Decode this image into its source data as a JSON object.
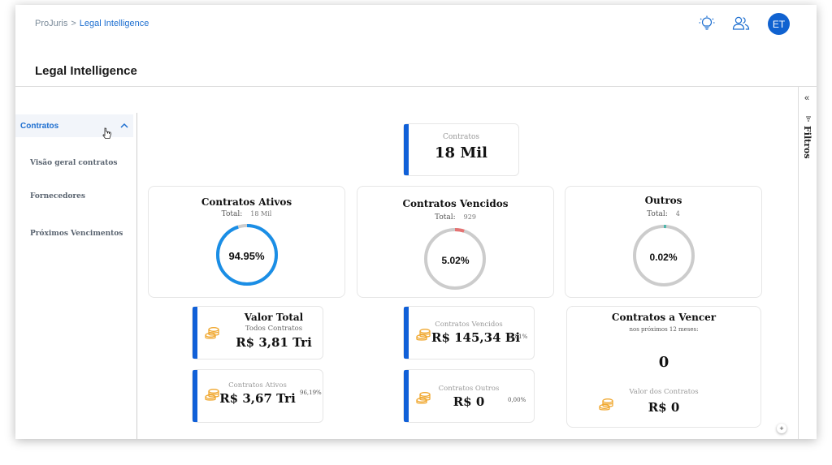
{
  "breadcrumb": {
    "root": "ProJuris",
    "separator": ">",
    "current": "Legal Intelligence"
  },
  "header": {
    "avatar_initials": "ET",
    "icons": [
      "lightbulb-icon",
      "users-icon"
    ]
  },
  "page": {
    "title": "Legal Intelligence"
  },
  "sidebar": {
    "section_label": "Contratos",
    "items": [
      {
        "label": "Visão geral contratos"
      },
      {
        "label": "Fornecedores"
      },
      {
        "label": "Próximos Vencimentos"
      }
    ]
  },
  "filters_panel": {
    "collapse_symbol": "«",
    "label": "Filtros"
  },
  "summary": {
    "label": "Contratos",
    "value": "18 Mil"
  },
  "gauges": [
    {
      "title": "Contratos Ativos",
      "total_label": "Total:",
      "total_value": "18 Mil",
      "percent_text": "94.95%",
      "percent": 94.95,
      "color": "#1a8ee6"
    },
    {
      "title": "Contratos Vencidos",
      "total_label": "Total:",
      "total_value": "929",
      "percent_text": "5.02%",
      "percent": 5.02,
      "color": "#e57373"
    },
    {
      "title": "Outros",
      "total_label": "Total:",
      "total_value": "4",
      "percent_text": "0.02%",
      "percent": 0.02,
      "color": "#4db6ac"
    }
  ],
  "valor_total": {
    "title": "Valor Total",
    "subtitle": "Todos Contratos",
    "value": "R$ 3,81 Tri"
  },
  "contratos_ativos_valor": {
    "label": "Contratos Ativos",
    "value": "R$ 3,67 Tri",
    "percent": "96,19%"
  },
  "contratos_vencidos_valor": {
    "label": "Contratos Vencidos",
    "value": "R$ 145,34 Bi",
    "percent": "3,81%"
  },
  "contratos_outros_valor": {
    "label": "Contratos Outros",
    "value": "R$ 0",
    "percent": "0,00%"
  },
  "contratos_a_vencer": {
    "title": "Contratos a Vencer",
    "subtitle": "nos próximos 12 meses:",
    "count": "0",
    "value_label": "Valor dos Contratos",
    "value": "R$ 0"
  },
  "colors": {
    "accent": "#1060d8",
    "link": "#1e6fd0",
    "coin": "#f0a830",
    "track": "#cccccc"
  }
}
